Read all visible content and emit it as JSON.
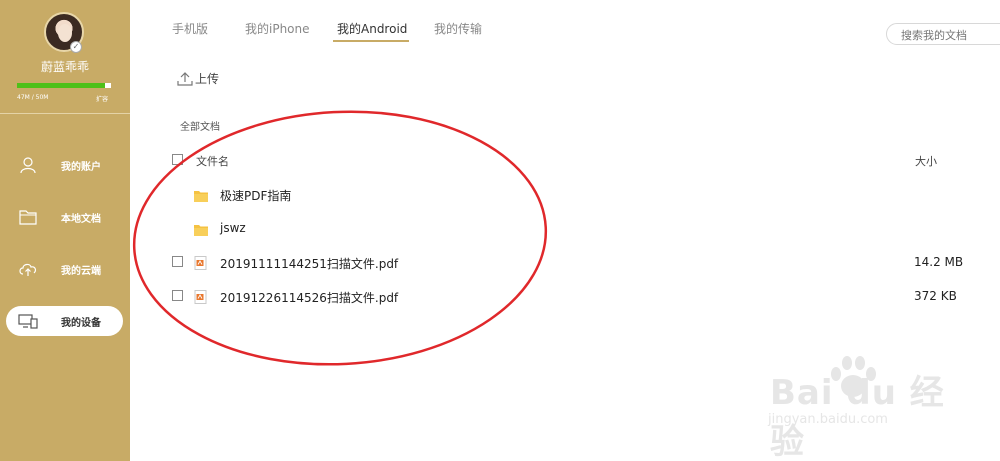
{
  "user": {
    "name": "蔚蓝乖乖",
    "quota_text": "47M / 50M",
    "quota_used_fraction": 0.94,
    "expand_label": "扩容"
  },
  "sidebar": {
    "items": [
      {
        "label": "我的账户",
        "icon": "user-icon",
        "active": false
      },
      {
        "label": "本地文档",
        "icon": "folder-icon",
        "active": false
      },
      {
        "label": "我的云端",
        "icon": "cloud-icon",
        "active": false
      },
      {
        "label": "我的设备",
        "icon": "device-icon",
        "active": true
      }
    ]
  },
  "tabs": [
    "手机版",
    "我的iPhone",
    "我的Android",
    "我的传输"
  ],
  "active_tab": "我的Android",
  "search": {
    "placeholder": "搜索我的文档"
  },
  "toolbar": {
    "upload_label": "上传"
  },
  "breadcrumb": "全部文档",
  "file_list": {
    "columns": {
      "name": "文件名",
      "size": "大小"
    },
    "rows": [
      {
        "type": "folder",
        "name": "极速PDF指南",
        "size": ""
      },
      {
        "type": "folder",
        "name": "jswz",
        "size": ""
      },
      {
        "type": "pdf",
        "name": "20191111144251扫描文件.pdf",
        "size": "14.2 MB"
      },
      {
        "type": "pdf",
        "name": "20191226114526扫描文件.pdf",
        "size": "372 KB"
      }
    ]
  },
  "watermark": {
    "brand": "Bai du 经验",
    "url": "jingyan.baidu.com"
  },
  "colors": {
    "sidebar_bg": "#c8ab66",
    "accent": "#c8ab66",
    "quota_fill": "#4ec019",
    "annotation_red": "#e0282b",
    "folder_yellow": "#f5c242",
    "pdf_orange": "#e8772e"
  }
}
